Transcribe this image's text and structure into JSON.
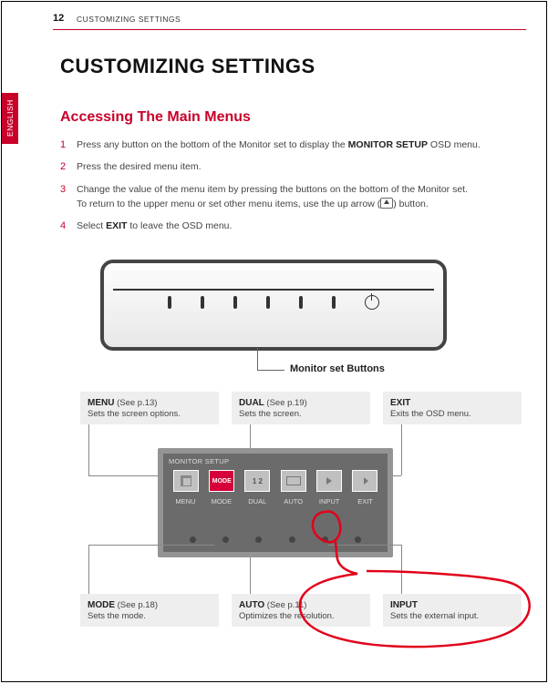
{
  "page_number": "12",
  "header_label": "CUSTOMIZING SETTINGS",
  "language_tab": "ENGLISH",
  "title": "CUSTOMIZING SETTINGS",
  "subtitle": "Accessing The Main Menus",
  "steps": [
    {
      "num": "1",
      "pre": "Press any button on the bottom of the Monitor set to display the ",
      "bold": "MONITOR SETUP",
      "post": " OSD menu."
    },
    {
      "num": "2",
      "pre": "Press the desired menu item.",
      "bold": "",
      "post": ""
    },
    {
      "num": "3",
      "pre": " Change the value of the menu item by pressing the buttons on the bottom of the Monitor set.\nTo return to the upper menu or set other menu items, use the up arrow (",
      "bold": "",
      "post": ") button.",
      "icon": "up-arrow"
    },
    {
      "num": "4",
      "pre": "Select ",
      "bold": "EXIT",
      "post": " to leave the OSD menu."
    }
  ],
  "monitor_caption": "Monitor set Buttons",
  "osd_title": "MONITOR SETUP",
  "osd_labels": [
    "MENU",
    "MODE",
    "DUAL",
    "AUTO",
    "INPUT",
    "EXIT"
  ],
  "descriptions": {
    "menu": {
      "title": "MENU",
      "ref": "(See p.13)",
      "desc": "Sets the screen options."
    },
    "dual": {
      "title": "DUAL",
      "ref": "(See p.19)",
      "desc": "Sets the screen."
    },
    "exit": {
      "title": "EXIT",
      "ref": "",
      "desc": "Exits the OSD menu."
    },
    "mode": {
      "title": "MODE",
      "ref": "(See p.18)",
      "desc": "Sets the mode."
    },
    "auto": {
      "title": "AUTO",
      "ref": "(See p.11)",
      "desc": "Optimizes the resolution."
    },
    "input": {
      "title": "INPUT",
      "ref": "",
      "desc": "Sets the external input."
    }
  }
}
